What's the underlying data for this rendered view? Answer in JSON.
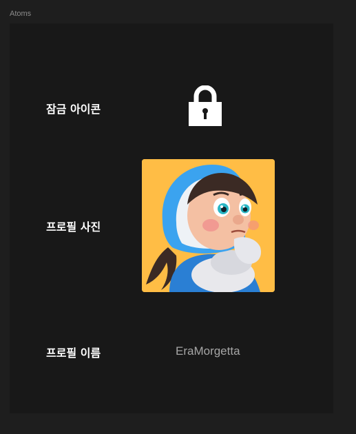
{
  "frame": {
    "title": "Atoms"
  },
  "rows": {
    "lock": {
      "label": "잠금 아이콘",
      "icon": "lock-icon"
    },
    "photo": {
      "label": "프로필 사진",
      "image": "cartoon-girl-avatar",
      "background": "#ffbd45"
    },
    "name": {
      "label": "프로필 이름",
      "value": "EraMorgetta"
    }
  },
  "colors": {
    "canvas": "#1e1e1e",
    "frame": "#181818",
    "label": "#ffffff",
    "value": "#a6a6a6"
  }
}
